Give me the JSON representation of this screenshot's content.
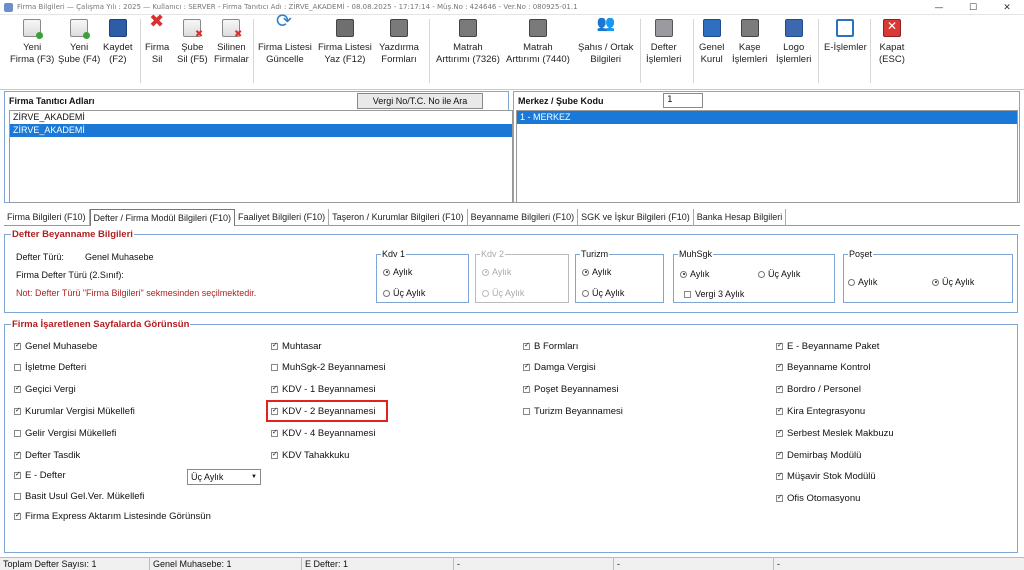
{
  "titlebar": {
    "text": "Firma Bilgileri  —  Çalışma Yılı : 2025    —  Kullanıcı : SERVER  - Firma Tanıtıcı Adı : ZİRVE_AKADEMİ - 08.08.2025 - 17:17:14  -  Müş.No : 424646  -  Ver.No : 080925-01.1"
  },
  "toolbar": {
    "yeni_firma": "Yeni\nFirma (F3)",
    "yeni_sube": "Yeni\nŞube (F4)",
    "kaydet": "Kaydet\n(F2)",
    "firma_sil": "Firma\nSil",
    "sube_sil": "Şube\nSil (F5)",
    "silinen": "Silinen\nFirmalar",
    "guncelle": "Firma Listesi\nGüncelle",
    "yaz": "Firma Listesi\nYaz (F12)",
    "yazdirma": "Yazdırma\nFormları",
    "matrah1": "Matrah\nArttırımı (7326)",
    "matrah2": "Matrah\nArttırımı (7440)",
    "sahis": "Şahıs / Ortak\nBilgileri",
    "defter": "Defter\nİşlemleri",
    "genel": "Genel\nKurul",
    "kase": "Kaşe\nİşlemleri",
    "logo": "Logo\nİşlemleri",
    "eislem": "E-İşlemler",
    "kapat": "Kapat\n(ESC)"
  },
  "firma_panel": {
    "header": "Firma Tanıtıcı Adları",
    "vergi_button": "Vergi No/T.C. No ile Ara",
    "items": [
      "ZİRVE_AKADEMİ",
      "ZİRVE_AKADEMİ"
    ]
  },
  "merkez_panel": {
    "header": "Merkez / Şube Kodu",
    "code_value": "1",
    "items": [
      "1 - MERKEZ"
    ]
  },
  "tabs": [
    "Firma Bilgileri (F10)",
    "Defter / Firma Modül Bilgileri (F10)",
    "Faaliyet Bilgileri (F10)",
    "Taşeron / Kurumlar Bilgileri (F10)",
    "Beyanname Bilgileri (F10)",
    "SGK ve İşkur Bilgileri (F10)",
    "Banka Hesap Bilgileri"
  ],
  "defter_beyan": {
    "title": "Defter Beyanname Bilgileri",
    "defter_turu_label": "Defter Türü:",
    "defter_turu_value": "Genel Muhasebe",
    "defter_turu2_label": "Firma Defter Türü (2.Sınıf):",
    "note": "Not: Defter Türü \"Firma Bilgileri\" sekmesinden seçilmektedir.",
    "kdv1": {
      "title": "Kdv 1",
      "opt1": "Aylık",
      "opt2": "Üç Aylık"
    },
    "kdv2": {
      "title": "Kdv 2",
      "opt1": "Aylık",
      "opt2": "Üç Aylık"
    },
    "turizm": {
      "title": "Turizm",
      "opt1": "Aylık",
      "opt2": "Üç Aylık"
    },
    "muhsgk": {
      "title": "MuhSgk",
      "opt1": "Aylık",
      "opt2": "Üç Aylık",
      "vergi3": "Vergi 3 Aylık"
    },
    "poset": {
      "title": "Poşet",
      "opt1": "Aylık",
      "opt2": "Üç Aylık"
    }
  },
  "sayfalar": {
    "title": "Firma İşaretlenen Sayfalarda Görünsün",
    "col1": [
      "Genel Muhasebe",
      "İşletme Defteri",
      "Geçici Vergi",
      "Kurumlar Vergisi Mükellefi",
      "Gelir Vergisi Mükellefi",
      "Defter Tasdik",
      "E - Defter",
      "Basit Usul Gel.Ver. Mükellefi",
      "Firma Express Aktarım Listesinde Görünsün"
    ],
    "col2": [
      "Muhtasar",
      "MuhSgk-2 Beyannamesi",
      "KDV - 1 Beyannamesi",
      "KDV - 2 Beyannamesi",
      "KDV - 4 Beyannamesi",
      "KDV Tahakkuku"
    ],
    "col3": [
      "B Formları",
      "Damga Vergisi",
      "Poşet Beyannamesi",
      "Turizm Beyannamesi"
    ],
    "col4": [
      "E - Beyanname Paket",
      "Beyanname Kontrol",
      "Bordro / Personel",
      "Kira Entegrasyonu",
      "Serbest Meslek Makbuzu",
      "Demirbaş Modülü",
      "Müşavir Stok Modülü",
      "Ofis Otomasyonu"
    ],
    "edefter_select": "Üç Aylık"
  },
  "status": {
    "toplam": "Toplam Defter Sayısı: 1",
    "genel": "Genel Muhasebe: 1",
    "edefter": "E Defter: 1",
    "d1": "-",
    "d2": "-",
    "d3": "-"
  }
}
